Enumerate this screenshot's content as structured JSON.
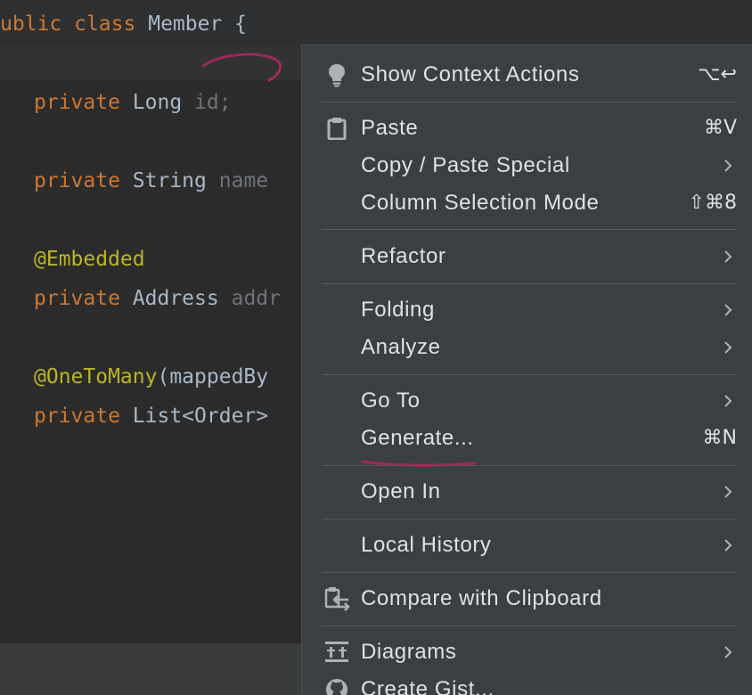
{
  "editor": {
    "header": {
      "keyword1": "ublic",
      "keyword2": "class",
      "class_name": "Member",
      "brace": "{"
    },
    "lines": [
      {
        "kw": "private",
        "type": "Long",
        "rest": "id;"
      },
      {
        "kw": "private",
        "type": "String",
        "rest": "name"
      },
      {
        "annotation": "@Embedded"
      },
      {
        "kw": "private",
        "type": "Address",
        "rest": "addr"
      },
      {
        "annotation": "@OneToMany",
        "rest": "(mappedBy"
      },
      {
        "kw": "private",
        "type": "List<Order>"
      }
    ]
  },
  "context_menu": {
    "items": [
      {
        "label": "Show Context Actions",
        "shortcut": "⌥↩",
        "icon": "lightbulb-icon"
      },
      {
        "label": "Paste",
        "shortcut": "⌘V",
        "icon": "clipboard-icon"
      },
      {
        "label": "Copy / Paste Special",
        "submenu": true
      },
      {
        "label": "Column Selection Mode",
        "shortcut": "⇧⌘8"
      },
      {
        "label": "Refactor",
        "submenu": true
      },
      {
        "label": "Folding",
        "submenu": true
      },
      {
        "label": "Analyze",
        "submenu": true
      },
      {
        "label": "Go To",
        "submenu": true
      },
      {
        "label": "Generate...",
        "shortcut": "⌘N"
      },
      {
        "label": "Open In",
        "submenu": true
      },
      {
        "label": "Local History",
        "submenu": true
      },
      {
        "label": "Compare with Clipboard",
        "icon": "compare-clipboard-icon"
      },
      {
        "label": "Diagrams",
        "submenu": true,
        "icon": "diagram-icon"
      },
      {
        "label": "Create Gist...",
        "icon": "github-icon"
      }
    ]
  },
  "colors": {
    "editor_bg": "#2b2b2b",
    "menu_bg": "#3c3f41",
    "keyword": "#cc7832",
    "annotation": "#bbb529",
    "code_text": "#a9b7c6",
    "dim_text": "#6f737a",
    "scribble": "#9c2a5c"
  }
}
